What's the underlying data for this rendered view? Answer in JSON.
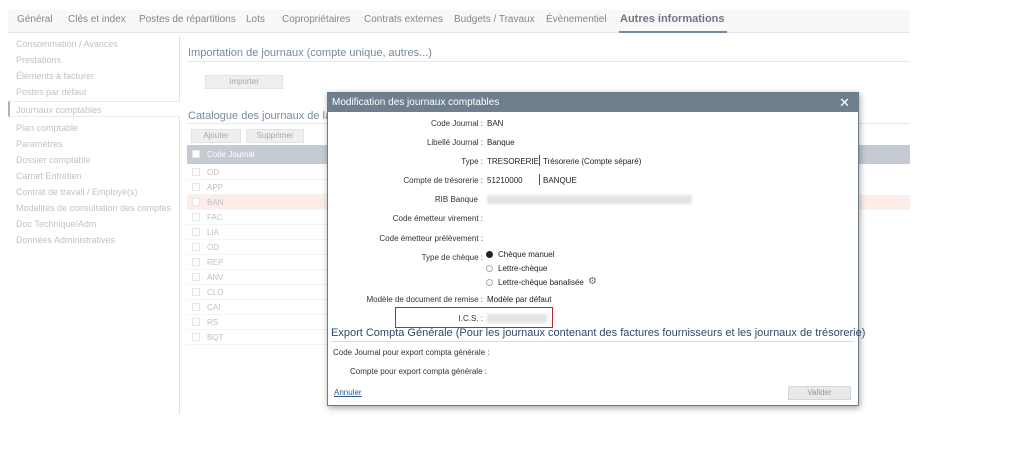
{
  "tabs": [
    {
      "label": "Général"
    },
    {
      "label": "Clés et index"
    },
    {
      "label": "Postes de répartitions"
    },
    {
      "label": "Lots"
    },
    {
      "label": "Copropriétaires"
    },
    {
      "label": "Contrats externes"
    },
    {
      "label": "Budgets / Travaux"
    },
    {
      "label": "Évènementiel"
    },
    {
      "label": "Autres informations"
    }
  ],
  "sidebar": {
    "items": [
      {
        "label": "Consommation / Avances"
      },
      {
        "label": "Prestations"
      },
      {
        "label": "Éléments à facturer"
      },
      {
        "label": "Postes par défaut"
      },
      {
        "label": "Journaux comptables"
      },
      {
        "label": "Plan comptable"
      },
      {
        "label": "Paramètres"
      },
      {
        "label": "Dossier comptable"
      },
      {
        "label": "Carnet Entretien"
      },
      {
        "label": "Contrat de travail / Employé(s)"
      },
      {
        "label": "Modalités de consultation des comptes"
      },
      {
        "label": "Doc Technique/Adm"
      },
      {
        "label": "Données Administratives"
      }
    ]
  },
  "main": {
    "import_title": "Importation de journaux (compte unique, autres...)",
    "import_button": "Importer",
    "catalog_title": "Catalogue des journaux de la c",
    "add_button": "Ajouter",
    "delete_button": "Supprimer",
    "column_code": "Code Journal",
    "rows": [
      "OD",
      "APP",
      "BAN",
      "FAC",
      "LIA",
      "OD",
      "REP",
      "ANV",
      "CLO",
      "CAI",
      "RS",
      "BQT"
    ]
  },
  "modal": {
    "title": "Modification des journaux comptables",
    "close": "✕",
    "code_label": "Code Journal :",
    "code_value": "BAN",
    "libelle_label": "Libellé Journal :",
    "libelle_value": "Banque",
    "type_label": "Type :",
    "type_value": "TRESORERIE",
    "type_desc": "Trésorerie (Compte séparé)",
    "compte_label": "Compte de trésorerie :",
    "compte_value": "51210000",
    "compte_desc": "BANQUE",
    "rib_label": "RIB Banque",
    "emetteur_virement_label": "Code émetteur virement :",
    "emetteur_prelevement_label": "Code émetteur prélèvement :",
    "cheque_label": "Type de chèque :",
    "cheque_options": [
      "Chèque manuel",
      "Lettre-chèque",
      "Lettre-chèque banalisée"
    ],
    "modele_label": "Modèle de document de remise :",
    "modele_value": "Modèle par défaut",
    "ics_label": "I.C.S. :",
    "export_title": "Export Compta Générale (Pour les journaux contenant des factures fournisseurs et les journaux de trésorerie)",
    "export_code_label": "Code Journal pour export compta générale :",
    "export_compte_label": "Compte pour export compta générale :",
    "cancel_link": "Annuler",
    "validate_button": "Valider"
  }
}
